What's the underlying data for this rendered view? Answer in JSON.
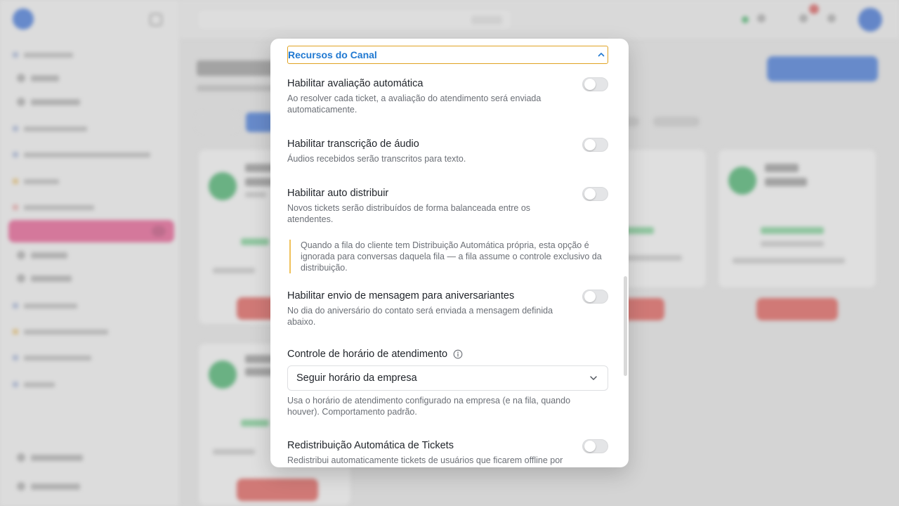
{
  "modal": {
    "section_title": "Recursos do Canal",
    "options": [
      {
        "title": "Habilitar avaliação automática",
        "desc": "Ao resolver cada ticket, a avaliação do atendimento será enviada automaticamente.",
        "enabled": false
      },
      {
        "title": "Habilitar transcrição de áudio",
        "desc": "Áudios recebidos serão transcritos para texto.",
        "enabled": false
      },
      {
        "title": "Habilitar auto distribuir",
        "desc": "Novos tickets serão distribuídos de forma balanceada entre os atendentes.",
        "enabled": false
      },
      {
        "title": "Habilitar envio de mensagem para aniversariantes",
        "desc": "No dia do aniversário do contato será enviada a mensagem definida abaixo.",
        "enabled": false
      },
      {
        "title": "Redistribuição Automática de Tickets",
        "desc": "Redistribui automaticamente tickets de usuários que ficarem offline por",
        "enabled": false
      }
    ],
    "auto_distribute_note": "Quando a fila do cliente tem Distribuição Automática própria, esta opção é ignorada para conversas daquela fila — a fila assume o controle exclusivo da distribuição.",
    "schedule_control": {
      "label": "Controle de horário de atendimento",
      "selected": "Seguir horário da empresa",
      "help": "Usa o horário de atendimento configurado na empresa (e na fila, quando houver). Comportamento padrão."
    }
  },
  "colors": {
    "accent_blue": "#1f78d1",
    "focus_outline": "#e0a323",
    "note_border": "#f0c15a",
    "sidebar_active": "#d6497f",
    "primary_button": "#2e65c7",
    "online_green": "#34a05a",
    "delete_red": "#cf4a45"
  }
}
